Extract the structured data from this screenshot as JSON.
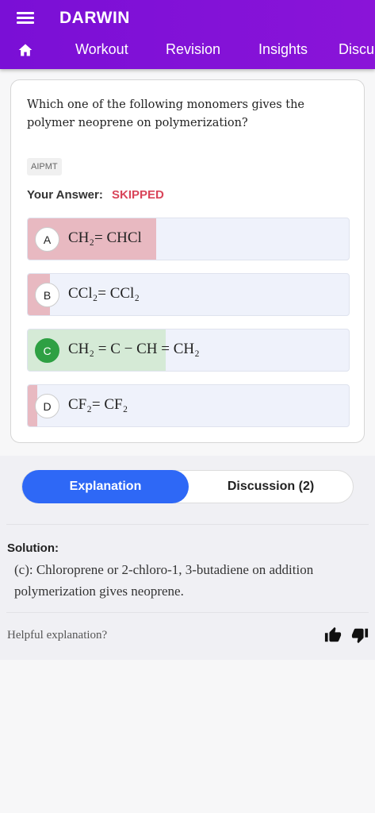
{
  "app": {
    "title": "DARWIN"
  },
  "nav": {
    "home_icon": "home-icon",
    "items": [
      {
        "label": "Workout"
      },
      {
        "label": "Revision"
      },
      {
        "label": "Insights"
      },
      {
        "label": "Discu"
      }
    ]
  },
  "question": {
    "text": "Which one of the following monomers gives the polymer neoprene on polymerization?",
    "tag": "AIPMT",
    "your_answer_label": "Your Answer:",
    "your_answer_value": "SKIPPED"
  },
  "options": [
    {
      "letter": "A",
      "text": "CH₂= CHCl",
      "status": "incorrect",
      "percent": 40
    },
    {
      "letter": "B",
      "text": "CCl₂= CCl₂",
      "status": "incorrect",
      "percent": 7
    },
    {
      "letter": "C",
      "text": "CH₂ = C − CH = CH₂",
      "status": "correct",
      "percent": 43
    },
    {
      "letter": "D",
      "text": "CF₂= CF₂",
      "status": "incorrect",
      "percent": 3
    }
  ],
  "colors": {
    "appbar": "#7a0fd6",
    "incorrect_fill": "#e8b9c1",
    "correct_fill": "#d5ead6",
    "correct_badge": "#2ea043",
    "tab_active": "#2e68f6",
    "skipped": "#d9455a"
  },
  "tabs": {
    "explanation": "Explanation",
    "discussion": "Discussion (2)"
  },
  "solution": {
    "label": "Solution:",
    "text": "(c): Chloroprene or 2-chloro-1, 3-butadiene on addition polymerization gives neoprene."
  },
  "feedback": {
    "prompt": "Helpful explanation?",
    "up_icon": "thumbs-up-icon",
    "down_icon": "thumbs-down-icon"
  }
}
